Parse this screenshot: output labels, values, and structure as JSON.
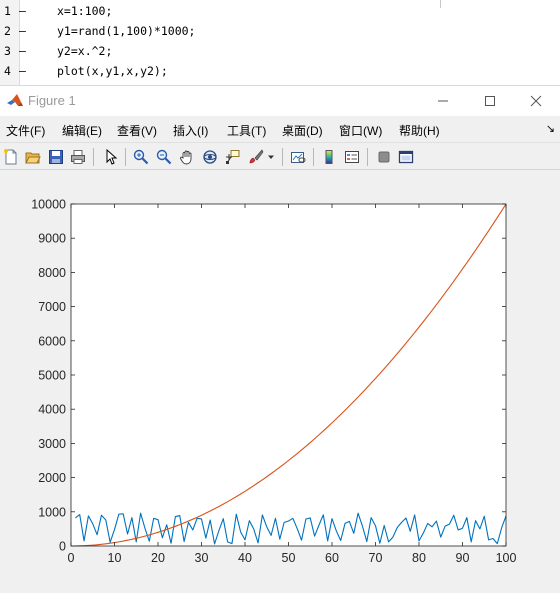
{
  "editor": {
    "lines": [
      {
        "number": "1",
        "marker": "–",
        "code": "x=1:100;"
      },
      {
        "number": "2",
        "marker": "–",
        "code": "y1=rand(1,100)*1000;"
      },
      {
        "number": "3",
        "marker": "–",
        "code": "y2=x.^2;"
      },
      {
        "number": "4",
        "marker": "–",
        "code": "plot(x,y1,x,y2);"
      }
    ]
  },
  "window": {
    "title": "Figure 1",
    "icon": "matlab-logo-icon",
    "controls": [
      "minimize-icon",
      "maximize-icon",
      "close-icon"
    ]
  },
  "menubar": {
    "items": [
      "文件(F)",
      "编辑(E)",
      "查看(V)",
      "插入(I)",
      "工具(T)",
      "桌面(D)",
      "窗口(W)",
      "帮助(H)"
    ],
    "overflow_icon": "menu-overflow-arrow-icon"
  },
  "toolbar": {
    "buttons": [
      "new-figure-icon",
      "open-file-icon",
      "save-figure-icon",
      "print-figure-icon",
      "edit-plot-arrow-icon",
      "zoom-in-icon",
      "zoom-out-icon",
      "pan-hand-icon",
      "rotate-3d-icon",
      "data-cursor-icon",
      "brush-icon",
      "brush-dropdown-icon",
      "link-plot-icon",
      "insert-colorbar-icon",
      "insert-legend-icon",
      "hide-plot-tools-icon",
      "show-plot-tools-icon"
    ]
  },
  "colors": {
    "series1": "#0072bd",
    "series2": "#d95319",
    "axes_background": "#ffffff",
    "figure_background": "#f0f0f0"
  },
  "chart_data": {
    "type": "line",
    "title": "",
    "xlabel": "",
    "ylabel": "",
    "xlim": [
      0,
      100
    ],
    "ylim": [
      0,
      10000
    ],
    "xticks": [
      0,
      10,
      20,
      30,
      40,
      50,
      60,
      70,
      80,
      90,
      100
    ],
    "yticks": [
      0,
      1000,
      2000,
      3000,
      4000,
      5000,
      6000,
      7000,
      8000,
      9000,
      10000
    ],
    "grid": false,
    "legend": "none",
    "x": [
      1,
      2,
      3,
      4,
      5,
      6,
      7,
      8,
      9,
      10,
      11,
      12,
      13,
      14,
      15,
      16,
      17,
      18,
      19,
      20,
      21,
      22,
      23,
      24,
      25,
      26,
      27,
      28,
      29,
      30,
      31,
      32,
      33,
      34,
      35,
      36,
      37,
      38,
      39,
      40,
      41,
      42,
      43,
      44,
      45,
      46,
      47,
      48,
      49,
      50,
      51,
      52,
      53,
      54,
      55,
      56,
      57,
      58,
      59,
      60,
      61,
      62,
      63,
      64,
      65,
      66,
      67,
      68,
      69,
      70,
      71,
      72,
      73,
      74,
      75,
      76,
      77,
      78,
      79,
      80,
      81,
      82,
      83,
      84,
      85,
      86,
      87,
      88,
      89,
      90,
      91,
      92,
      93,
      94,
      95,
      96,
      97,
      98,
      99,
      100
    ],
    "series": [
      {
        "values": [
          820,
          920,
          150,
          880,
          650,
          330,
          900,
          760,
          110,
          480,
          930,
          940,
          350,
          830,
          120,
          960,
          520,
          140,
          810,
          770,
          240,
          620,
          80,
          860,
          890,
          130,
          690,
          470,
          810,
          790,
          230,
          760,
          60,
          450,
          800,
          120,
          70,
          930,
          410,
          180,
          740,
          500,
          90,
          910,
          560,
          310,
          810,
          200,
          690,
          730,
          810,
          510,
          170,
          790,
          820,
          290,
          610,
          910,
          150,
          800,
          440,
          160,
          660,
          720,
          370,
          960,
          580,
          130,
          830,
          590,
          80,
          600,
          120,
          260,
          540,
          690,
          820,
          430,
          910,
          150,
          380,
          660,
          560,
          730,
          260,
          580,
          640,
          900,
          470,
          520,
          830,
          120,
          740,
          500,
          870,
          180,
          220,
          70,
          530,
          880
        ]
      },
      {
        "values": [
          1,
          4,
          9,
          16,
          25,
          36,
          49,
          64,
          81,
          100,
          121,
          144,
          169,
          196,
          225,
          256,
          289,
          324,
          361,
          400,
          441,
          484,
          529,
          576,
          625,
          676,
          729,
          784,
          841,
          900,
          961,
          1024,
          1089,
          1156,
          1225,
          1296,
          1369,
          1444,
          1521,
          1600,
          1681,
          1764,
          1849,
          1936,
          2025,
          2116,
          2209,
          2304,
          2401,
          2500,
          2601,
          2704,
          2809,
          2916,
          3025,
          3136,
          3249,
          3364,
          3481,
          3600,
          3721,
          3844,
          3969,
          4096,
          4225,
          4356,
          4489,
          4624,
          4761,
          4900,
          5041,
          5184,
          5329,
          5476,
          5625,
          5776,
          5929,
          6084,
          6241,
          6400,
          6561,
          6724,
          6889,
          7056,
          7225,
          7396,
          7569,
          7744,
          7921,
          8100,
          8281,
          8464,
          8649,
          8836,
          9025,
          9216,
          9409,
          9604,
          9801,
          10000
        ]
      }
    ]
  }
}
